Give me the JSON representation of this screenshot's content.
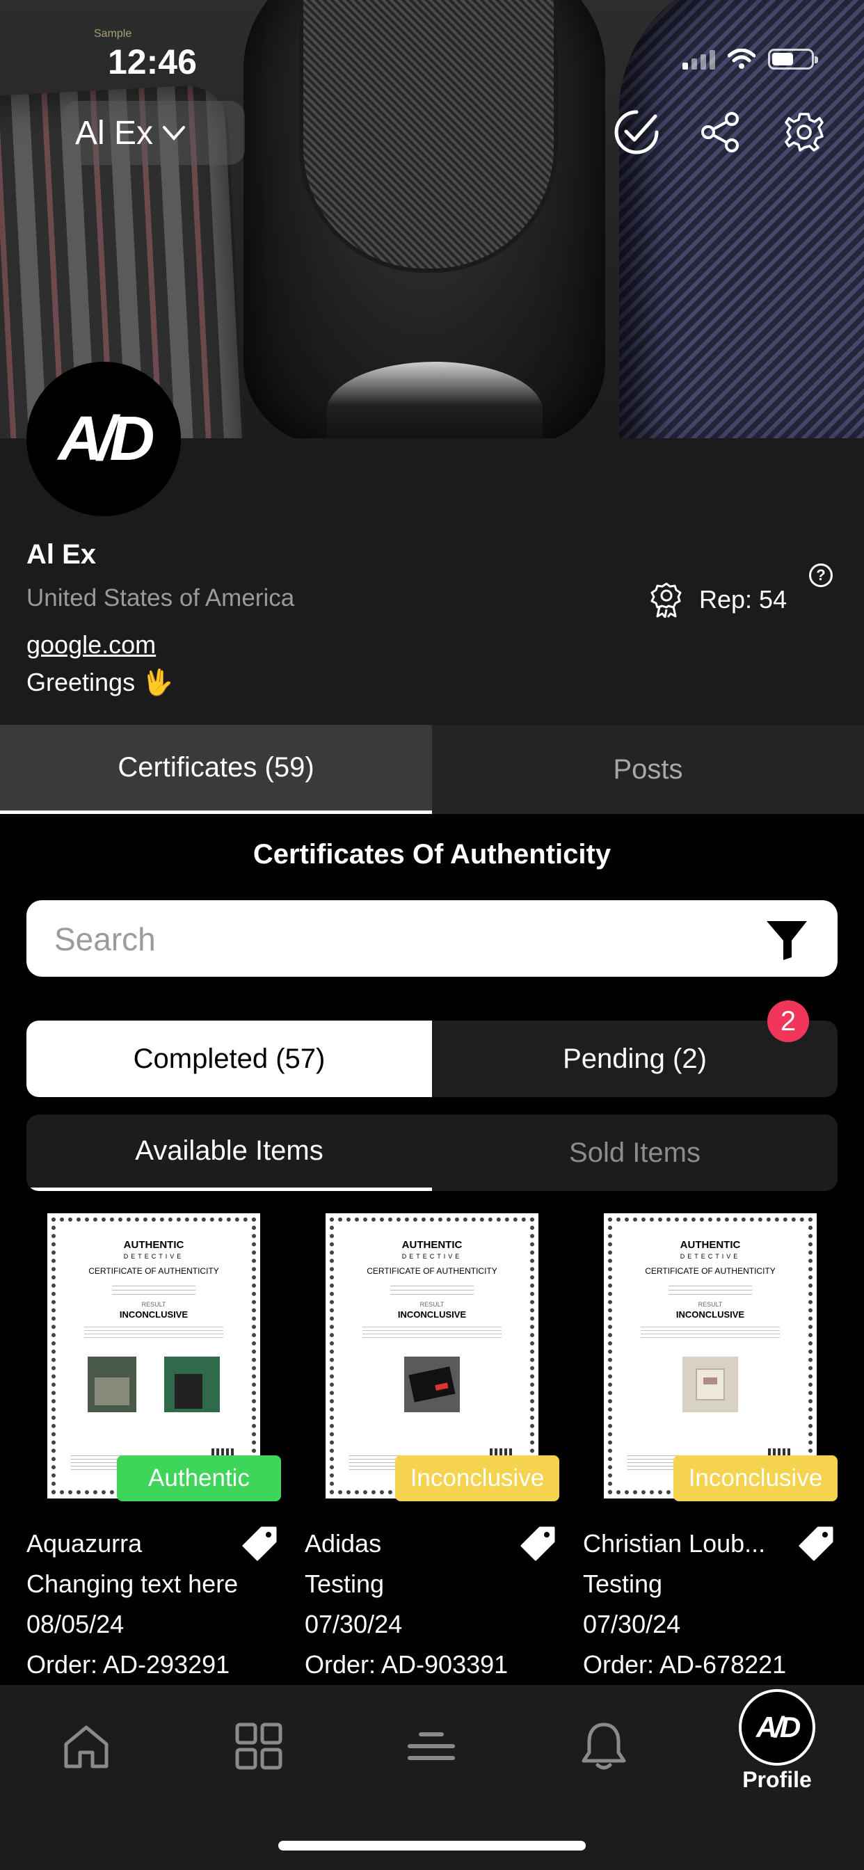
{
  "status_bar": {
    "time": "12:46"
  },
  "banner": {
    "watermark": "Sample"
  },
  "header": {
    "account_name": "Al Ex",
    "account_chevron": "chevron-down-icon"
  },
  "profile": {
    "avatar_logo": "A/D",
    "name": "Al Ex",
    "country": "United States of America",
    "website": "google.com",
    "bio": "Greetings 🖖",
    "rep_label": "Rep: 54",
    "help_glyph": "?"
  },
  "profile_tabs": [
    {
      "label": "Certificates (59)",
      "active": true
    },
    {
      "label": "Posts",
      "active": false
    }
  ],
  "section_title": "Certificates Of Authenticity",
  "search": {
    "placeholder": "Search",
    "value": ""
  },
  "status_segment": {
    "completed": "Completed (57)",
    "pending": "Pending (2)",
    "pending_badge": "2"
  },
  "item_tabs": {
    "available": "Available Items",
    "sold": "Sold Items"
  },
  "certificate_thumbnail": {
    "brand": "AUTHENTIC",
    "brand_sub": "DETECTIVE",
    "title": "CERTIFICATE OF AUTHENTICITY",
    "result_label": "RESULT",
    "result": "INCONCLUSIVE"
  },
  "cards": [
    {
      "brand": "Aquazurra",
      "note": "Changing text here",
      "date": "08/05/24",
      "order": "Order: AD-293291",
      "status": "Authentic",
      "status_color": "#3ed65a"
    },
    {
      "brand": "Adidas",
      "note": "Testing",
      "date": "07/30/24",
      "order": "Order: AD-903391",
      "status": "Inconclusive",
      "status_color": "#f5d34f"
    },
    {
      "brand": "Christian Loub...",
      "note": "Testing",
      "date": "07/30/24",
      "order": "Order: AD-678221",
      "status": "Inconclusive",
      "status_color": "#f5d34f"
    }
  ],
  "bottom_nav": {
    "items": [
      "home-icon",
      "grid-icon",
      "list-icon",
      "bell-icon"
    ],
    "profile_logo": "A/D",
    "profile_label": "Profile"
  },
  "colors": {
    "accent_green": "#3ed65a",
    "accent_yellow": "#f5d34f",
    "badge_red": "#f2355b",
    "background": "#000000"
  }
}
